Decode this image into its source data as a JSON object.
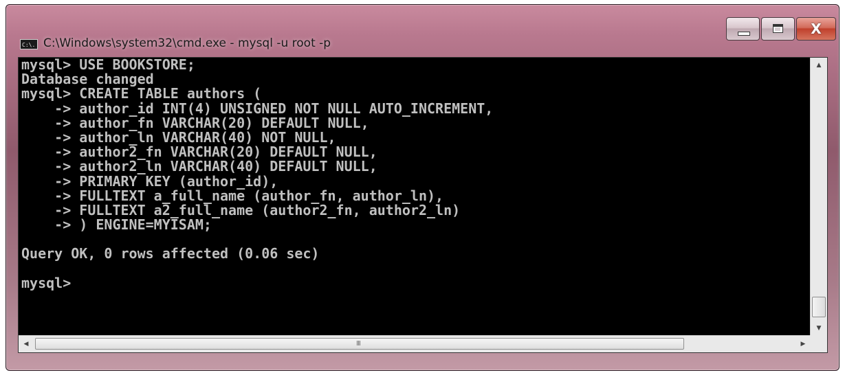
{
  "window": {
    "title": "C:\\Windows\\system32\\cmd.exe - mysql  -u root -p",
    "icon_label": "C:\\."
  },
  "controls": {
    "minimize_icon": "minimize-icon",
    "maximize_icon": "maximize-icon",
    "close_glyph": "X"
  },
  "console": {
    "lines": [
      "mysql> USE BOOKSTORE;",
      "Database changed",
      "mysql> CREATE TABLE authors (",
      "    -> author_id INT(4) UNSIGNED NOT NULL AUTO_INCREMENT,",
      "    -> author_fn VARCHAR(20) DEFAULT NULL,",
      "    -> author_ln VARCHAR(40) NOT NULL,",
      "    -> author2_fn VARCHAR(20) DEFAULT NULL,",
      "    -> author2_ln VARCHAR(40) DEFAULT NULL,",
      "    -> PRIMARY KEY (author_id),",
      "    -> FULLTEXT a_full_name (author_fn, author_ln),",
      "    -> FULLTEXT a2_full_name (author2_fn, author2_ln)",
      "    -> ) ENGINE=MYISAM;",
      "",
      "Query OK, 0 rows affected (0.06 sec)",
      "",
      "mysql>"
    ]
  },
  "scrollbars": {
    "up_arrow": "▲",
    "down_arrow": "▼",
    "left_arrow": "◀",
    "right_arrow": "▶",
    "grip": "III"
  }
}
